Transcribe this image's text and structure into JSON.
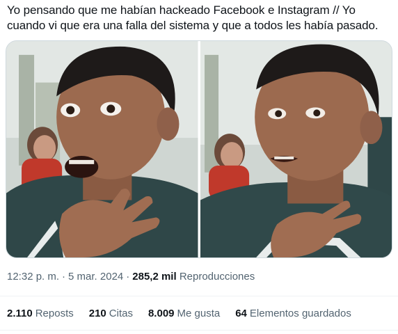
{
  "tweet": {
    "text": "Yo pensando que me habían hackeado Facebook e Instagram // Yo cuando vi que era una falla del sistema y que a todos les había pasado."
  },
  "media": {
    "photos": [
      {
        "name": "shocked-boy-photo"
      },
      {
        "name": "relieved-boy-photo"
      }
    ]
  },
  "meta": {
    "time": "12:32 p. m.",
    "date": "5 mar. 2024",
    "views_count": "285,2 mil",
    "views_label": "Reproducciones"
  },
  "stats": {
    "reposts_count": "2.110",
    "reposts_label": "Reposts",
    "quotes_count": "210",
    "quotes_label": "Citas",
    "likes_count": "8.009",
    "likes_label": "Me gusta",
    "bookmarks_count": "64",
    "bookmarks_label": "Elementos guardados"
  },
  "colors": {
    "text": "#0f1419",
    "secondary": "#536471",
    "border": "#cfd9de"
  }
}
